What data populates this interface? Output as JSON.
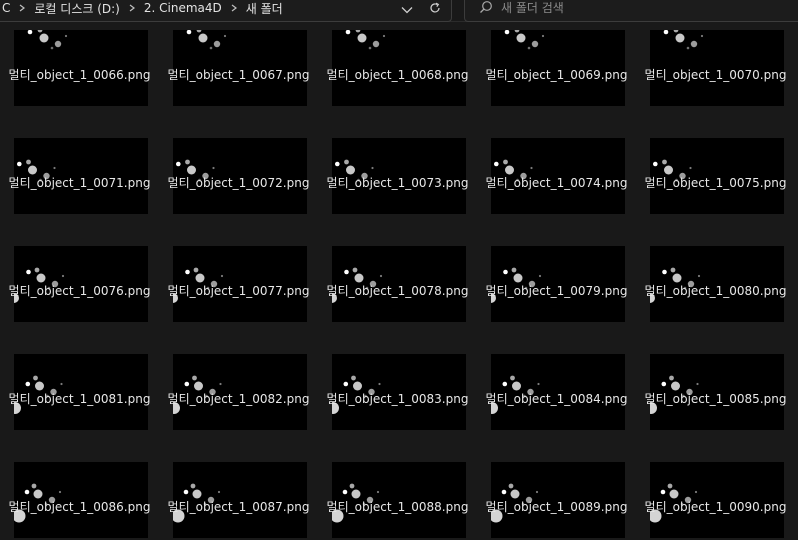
{
  "address_bar": {
    "breadcrumbs": [
      "C",
      "로컬 디스크 (D:)",
      "2. Cinema4D",
      "새 폴더"
    ],
    "history_icon": "chevron-down-icon",
    "refresh_icon": "refresh-icon"
  },
  "search": {
    "placeholder": "새 폴더 검색",
    "value": ""
  },
  "files": [
    "멀티_object_1_0066.png",
    "멀티_object_1_0067.png",
    "멀티_object_1_0068.png",
    "멀티_object_1_0069.png",
    "멀티_object_1_0070.png",
    "멀티_object_1_0071.png",
    "멀티_object_1_0072.png",
    "멀티_object_1_0073.png",
    "멀티_object_1_0074.png",
    "멀티_object_1_0075.png",
    "멀티_object_1_0076.png",
    "멀티_object_1_0077.png",
    "멀티_object_1_0078.png",
    "멀티_object_1_0079.png",
    "멀티_object_1_0080.png",
    "멀티_object_1_0081.png",
    "멀티_object_1_0082.png",
    "멀티_object_1_0083.png",
    "멀티_object_1_0084.png",
    "멀티_object_1_0085.png",
    "멀티_object_1_0086.png",
    "멀티_object_1_0087.png",
    "멀티_object_1_0088.png",
    "멀티_object_1_0089.png",
    "멀티_object_1_0090.png"
  ]
}
